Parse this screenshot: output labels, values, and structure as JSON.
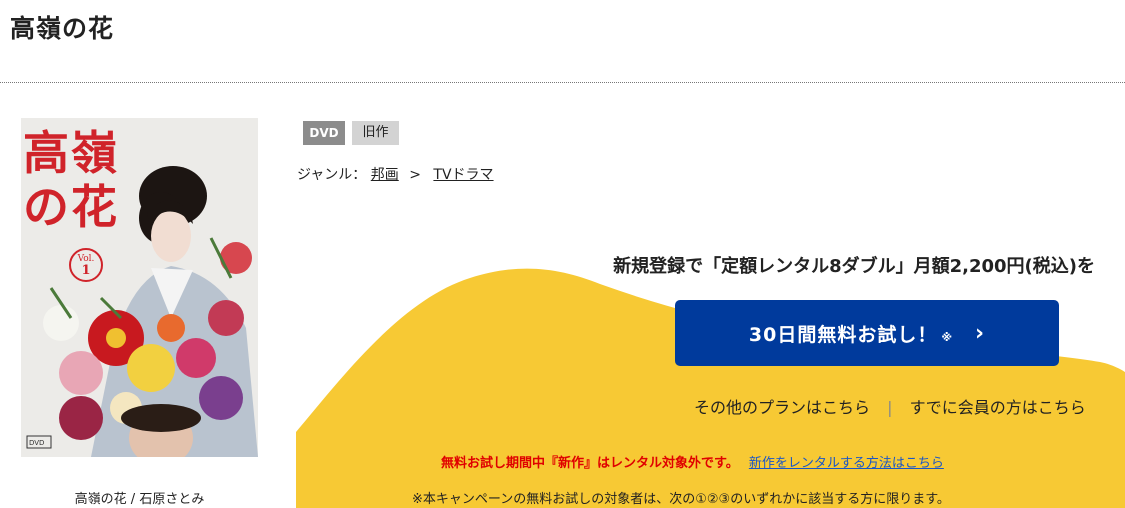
{
  "page_title": "高嶺の花",
  "jacket": {
    "title_chars": "高嶺の花",
    "vol_label": "Vol.",
    "vol_number": "1",
    "caption": "高嶺の花 / 石原さとみ"
  },
  "tags": {
    "format": "DVD",
    "release": "旧作"
  },
  "genre": {
    "label": "ジャンル：",
    "crumbs": [
      "邦画",
      "TVドラマ"
    ],
    "separator": ">"
  },
  "promo": {
    "headline": "新規登録で「定額レンタル8ダブル」月額2,200円(税込)を",
    "trial_button_label": "30日間無料お試し！",
    "trial_button_note": "※",
    "trial_button_chevron": "›",
    "other_plans_link": "その他のプランはこちら",
    "links_separator": "|",
    "member_link": "すでに会員の方はこちら",
    "warning_text": "無料お試し期間中『新作』はレンタル対象外です。",
    "warning_link": "新作をレンタルする方法はこちら",
    "notice": "※本キャンペーンの無料お試しの対象者は、次の①②③のいずれかに該当する方に限ります。"
  },
  "colors": {
    "accent_yellow": "#f7c934",
    "button_blue": "#003a9c",
    "warning_red": "#e00000",
    "link_blue": "#1a56c7"
  }
}
